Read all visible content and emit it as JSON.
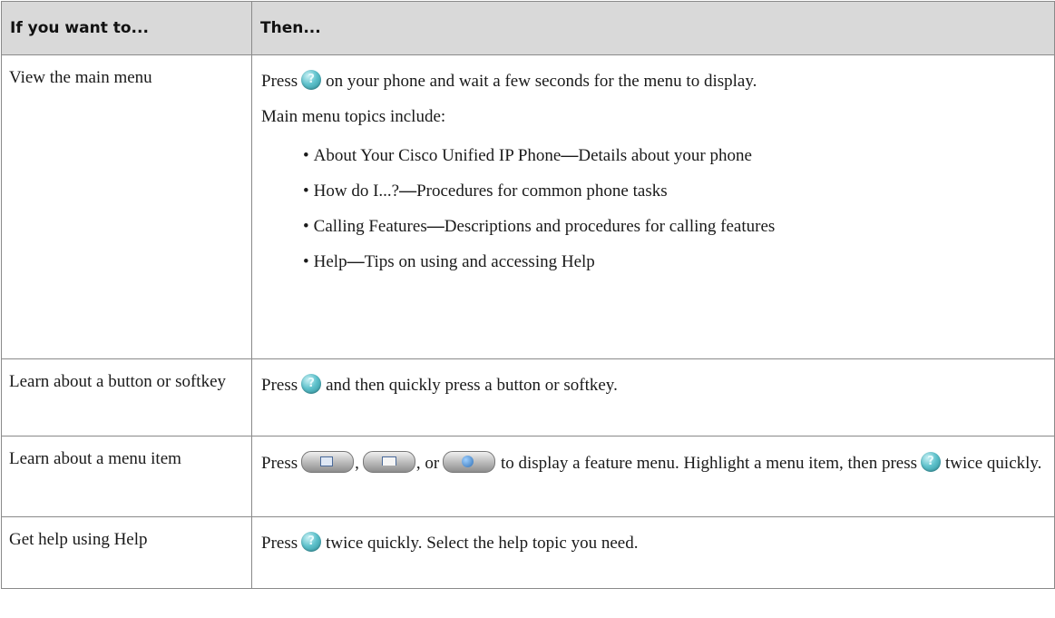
{
  "header": {
    "col1": "If you want to...",
    "col2": "Then..."
  },
  "rows": [
    {
      "task": "View the main menu",
      "p1_before": "Press",
      "p1_after": "on your phone and wait a few seconds for the menu to display.",
      "p2": "Main menu topics include:",
      "topics": [
        {
          "name": "About Your Cisco Unified IP Phone",
          "desc": "Details about your phone"
        },
        {
          "name": "How do I...?",
          "desc": "Procedures for common phone tasks"
        },
        {
          "name": "Calling Features",
          "desc": "Descriptions and procedures for calling features"
        },
        {
          "name": "Help",
          "desc": "Tips on using and accessing Help"
        }
      ]
    },
    {
      "task": "Learn about a button or softkey",
      "before": "Press",
      "after": "and then quickly press a button or softkey."
    },
    {
      "task": "Learn about a menu item",
      "before": "Press",
      "sep1": ",",
      "sep2": ", or",
      "mid": "to display a feature menu. Highlight a menu item, then press",
      "after": "twice quickly."
    },
    {
      "task": "Get help using Help",
      "before": "Press",
      "after": "twice quickly. Select the help topic you need."
    }
  ],
  "separator": "—",
  "icons": {
    "help": "help-button-icon",
    "services": "services-button-icon",
    "directories": "directories-button-icon",
    "settings": "settings-button-icon"
  }
}
